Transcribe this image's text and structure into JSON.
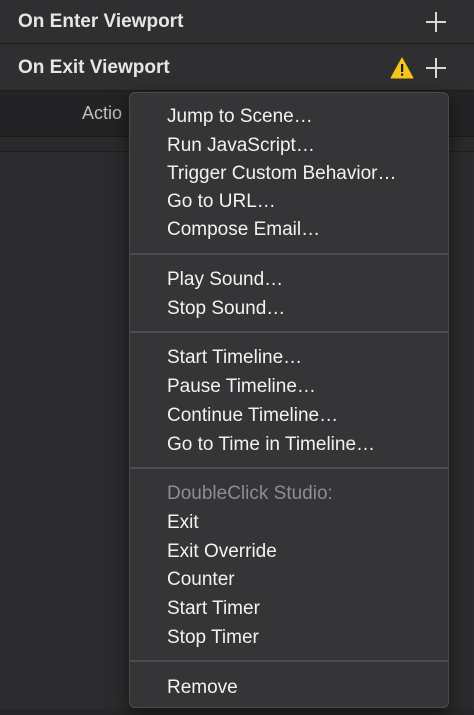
{
  "events": {
    "enter_label": "On Enter Viewport",
    "exit_label": "On Exit Viewport"
  },
  "subheader": {
    "label": "Actio"
  },
  "colors": {
    "warning": "#f5c518",
    "menu_bg": "#353538",
    "panel_bg": "#2b2b2d"
  },
  "menu": {
    "group1": [
      "Jump to Scene…",
      "Run JavaScript…",
      "Trigger Custom Behavior…",
      "Go to URL…",
      "Compose Email…"
    ],
    "group2": [
      "Play Sound…",
      "Stop Sound…"
    ],
    "group3": [
      "Start Timeline…",
      "Pause Timeline…",
      "Continue Timeline…",
      "Go to Time in Timeline…"
    ],
    "group4_header": "DoubleClick Studio:",
    "group4": [
      "Exit",
      "Exit Override",
      "Counter",
      "Start Timer",
      "Stop Timer"
    ],
    "remove": "Remove"
  }
}
